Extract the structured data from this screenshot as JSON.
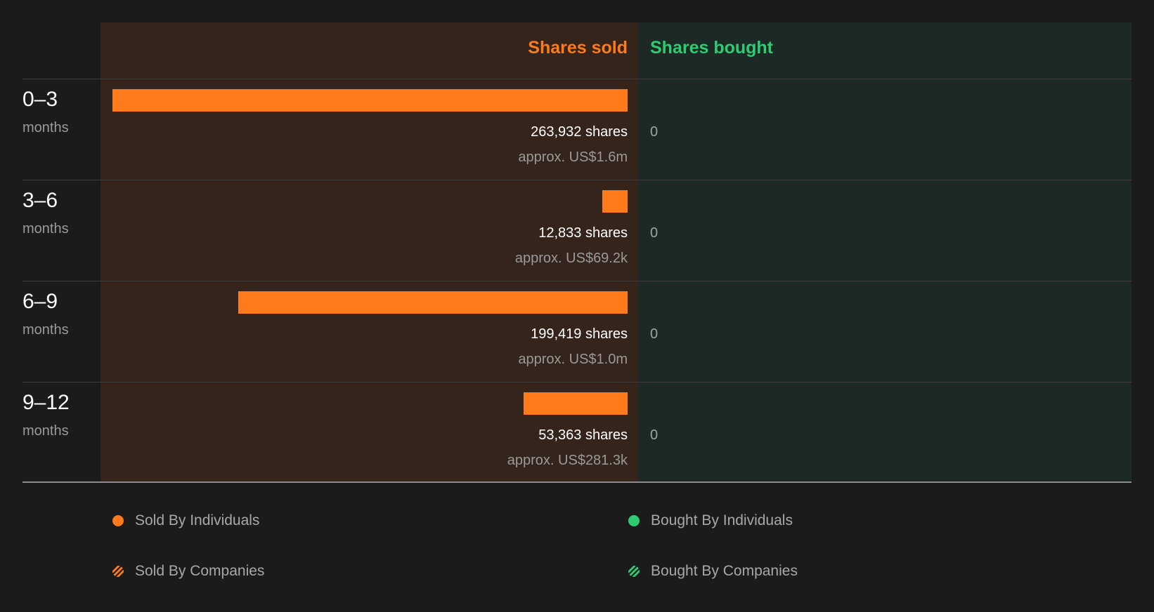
{
  "colors": {
    "sold": "#ff7a1a",
    "bought": "#2ecc71",
    "sold_bg": "#34241b",
    "bought_bg": "#1c2924"
  },
  "chart_data": {
    "type": "bar",
    "headers": {
      "sold": "Shares sold",
      "bought": "Shares bought"
    },
    "categories": [
      {
        "period": "0–3",
        "unit": "months"
      },
      {
        "period": "3–6",
        "unit": "months"
      },
      {
        "period": "6–9",
        "unit": "months"
      },
      {
        "period": "9–12",
        "unit": "months"
      }
    ],
    "series": [
      {
        "name": "Shares sold",
        "values": [
          263932,
          12833,
          199419,
          53363
        ],
        "labels": [
          "263,932 shares",
          "12,833 shares",
          "199,419 shares",
          "53,363 shares"
        ],
        "value_labels": [
          "approx. US$1.6m",
          "approx. US$69.2k",
          "approx. US$1.0m",
          "approx. US$281.3k"
        ]
      },
      {
        "name": "Shares bought",
        "values": [
          0,
          0,
          0,
          0
        ],
        "labels": [
          "0",
          "0",
          "0",
          "0"
        ]
      }
    ],
    "legend": [
      {
        "label": "Sold By Individuals",
        "swatch": "solid",
        "color": "#ff7a1a",
        "position": "bottom-left"
      },
      {
        "label": "Bought By Individuals",
        "swatch": "solid",
        "color": "#2ecc71",
        "position": "bottom-right"
      },
      {
        "label": "Sold By Companies",
        "swatch": "striped",
        "color": "#ff7a1a",
        "position": "bottom-left"
      },
      {
        "label": "Bought By Companies",
        "swatch": "striped",
        "color": "#2ecc71",
        "position": "bottom-right"
      }
    ]
  }
}
